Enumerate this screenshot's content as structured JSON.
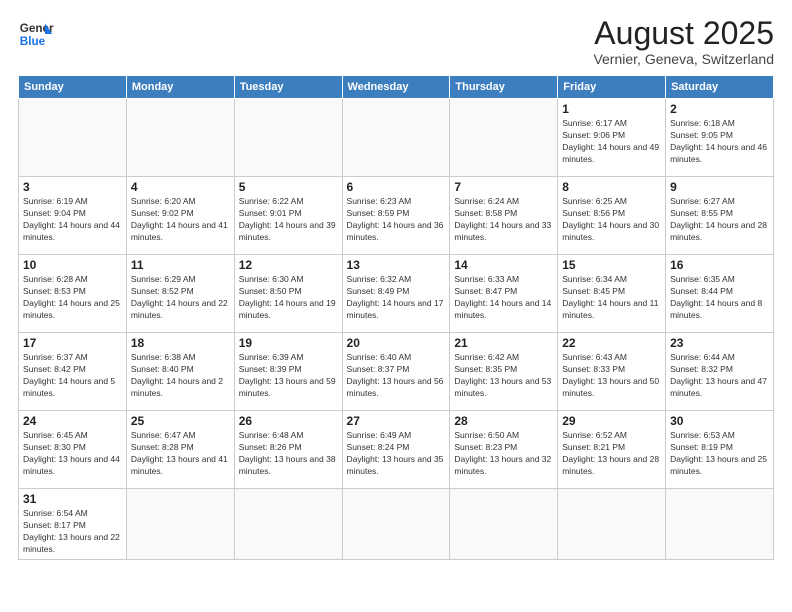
{
  "logo": {
    "line1": "General",
    "line2": "Blue"
  },
  "title": "August 2025",
  "subtitle": "Vernier, Geneva, Switzerland",
  "weekdays": [
    "Sunday",
    "Monday",
    "Tuesday",
    "Wednesday",
    "Thursday",
    "Friday",
    "Saturday"
  ],
  "weeks": [
    [
      {
        "day": "",
        "info": ""
      },
      {
        "day": "",
        "info": ""
      },
      {
        "day": "",
        "info": ""
      },
      {
        "day": "",
        "info": ""
      },
      {
        "day": "",
        "info": ""
      },
      {
        "day": "1",
        "info": "Sunrise: 6:17 AM\nSunset: 9:06 PM\nDaylight: 14 hours and 49 minutes."
      },
      {
        "day": "2",
        "info": "Sunrise: 6:18 AM\nSunset: 9:05 PM\nDaylight: 14 hours and 46 minutes."
      }
    ],
    [
      {
        "day": "3",
        "info": "Sunrise: 6:19 AM\nSunset: 9:04 PM\nDaylight: 14 hours and 44 minutes."
      },
      {
        "day": "4",
        "info": "Sunrise: 6:20 AM\nSunset: 9:02 PM\nDaylight: 14 hours and 41 minutes."
      },
      {
        "day": "5",
        "info": "Sunrise: 6:22 AM\nSunset: 9:01 PM\nDaylight: 14 hours and 39 minutes."
      },
      {
        "day": "6",
        "info": "Sunrise: 6:23 AM\nSunset: 8:59 PM\nDaylight: 14 hours and 36 minutes."
      },
      {
        "day": "7",
        "info": "Sunrise: 6:24 AM\nSunset: 8:58 PM\nDaylight: 14 hours and 33 minutes."
      },
      {
        "day": "8",
        "info": "Sunrise: 6:25 AM\nSunset: 8:56 PM\nDaylight: 14 hours and 30 minutes."
      },
      {
        "day": "9",
        "info": "Sunrise: 6:27 AM\nSunset: 8:55 PM\nDaylight: 14 hours and 28 minutes."
      }
    ],
    [
      {
        "day": "10",
        "info": "Sunrise: 6:28 AM\nSunset: 8:53 PM\nDaylight: 14 hours and 25 minutes."
      },
      {
        "day": "11",
        "info": "Sunrise: 6:29 AM\nSunset: 8:52 PM\nDaylight: 14 hours and 22 minutes."
      },
      {
        "day": "12",
        "info": "Sunrise: 6:30 AM\nSunset: 8:50 PM\nDaylight: 14 hours and 19 minutes."
      },
      {
        "day": "13",
        "info": "Sunrise: 6:32 AM\nSunset: 8:49 PM\nDaylight: 14 hours and 17 minutes."
      },
      {
        "day": "14",
        "info": "Sunrise: 6:33 AM\nSunset: 8:47 PM\nDaylight: 14 hours and 14 minutes."
      },
      {
        "day": "15",
        "info": "Sunrise: 6:34 AM\nSunset: 8:45 PM\nDaylight: 14 hours and 11 minutes."
      },
      {
        "day": "16",
        "info": "Sunrise: 6:35 AM\nSunset: 8:44 PM\nDaylight: 14 hours and 8 minutes."
      }
    ],
    [
      {
        "day": "17",
        "info": "Sunrise: 6:37 AM\nSunset: 8:42 PM\nDaylight: 14 hours and 5 minutes."
      },
      {
        "day": "18",
        "info": "Sunrise: 6:38 AM\nSunset: 8:40 PM\nDaylight: 14 hours and 2 minutes."
      },
      {
        "day": "19",
        "info": "Sunrise: 6:39 AM\nSunset: 8:39 PM\nDaylight: 13 hours and 59 minutes."
      },
      {
        "day": "20",
        "info": "Sunrise: 6:40 AM\nSunset: 8:37 PM\nDaylight: 13 hours and 56 minutes."
      },
      {
        "day": "21",
        "info": "Sunrise: 6:42 AM\nSunset: 8:35 PM\nDaylight: 13 hours and 53 minutes."
      },
      {
        "day": "22",
        "info": "Sunrise: 6:43 AM\nSunset: 8:33 PM\nDaylight: 13 hours and 50 minutes."
      },
      {
        "day": "23",
        "info": "Sunrise: 6:44 AM\nSunset: 8:32 PM\nDaylight: 13 hours and 47 minutes."
      }
    ],
    [
      {
        "day": "24",
        "info": "Sunrise: 6:45 AM\nSunset: 8:30 PM\nDaylight: 13 hours and 44 minutes."
      },
      {
        "day": "25",
        "info": "Sunrise: 6:47 AM\nSunset: 8:28 PM\nDaylight: 13 hours and 41 minutes."
      },
      {
        "day": "26",
        "info": "Sunrise: 6:48 AM\nSunset: 8:26 PM\nDaylight: 13 hours and 38 minutes."
      },
      {
        "day": "27",
        "info": "Sunrise: 6:49 AM\nSunset: 8:24 PM\nDaylight: 13 hours and 35 minutes."
      },
      {
        "day": "28",
        "info": "Sunrise: 6:50 AM\nSunset: 8:23 PM\nDaylight: 13 hours and 32 minutes."
      },
      {
        "day": "29",
        "info": "Sunrise: 6:52 AM\nSunset: 8:21 PM\nDaylight: 13 hours and 28 minutes."
      },
      {
        "day": "30",
        "info": "Sunrise: 6:53 AM\nSunset: 8:19 PM\nDaylight: 13 hours and 25 minutes."
      }
    ],
    [
      {
        "day": "31",
        "info": "Sunrise: 6:54 AM\nSunset: 8:17 PM\nDaylight: 13 hours and 22 minutes."
      },
      {
        "day": "",
        "info": ""
      },
      {
        "day": "",
        "info": ""
      },
      {
        "day": "",
        "info": ""
      },
      {
        "day": "",
        "info": ""
      },
      {
        "day": "",
        "info": ""
      },
      {
        "day": "",
        "info": ""
      }
    ]
  ]
}
